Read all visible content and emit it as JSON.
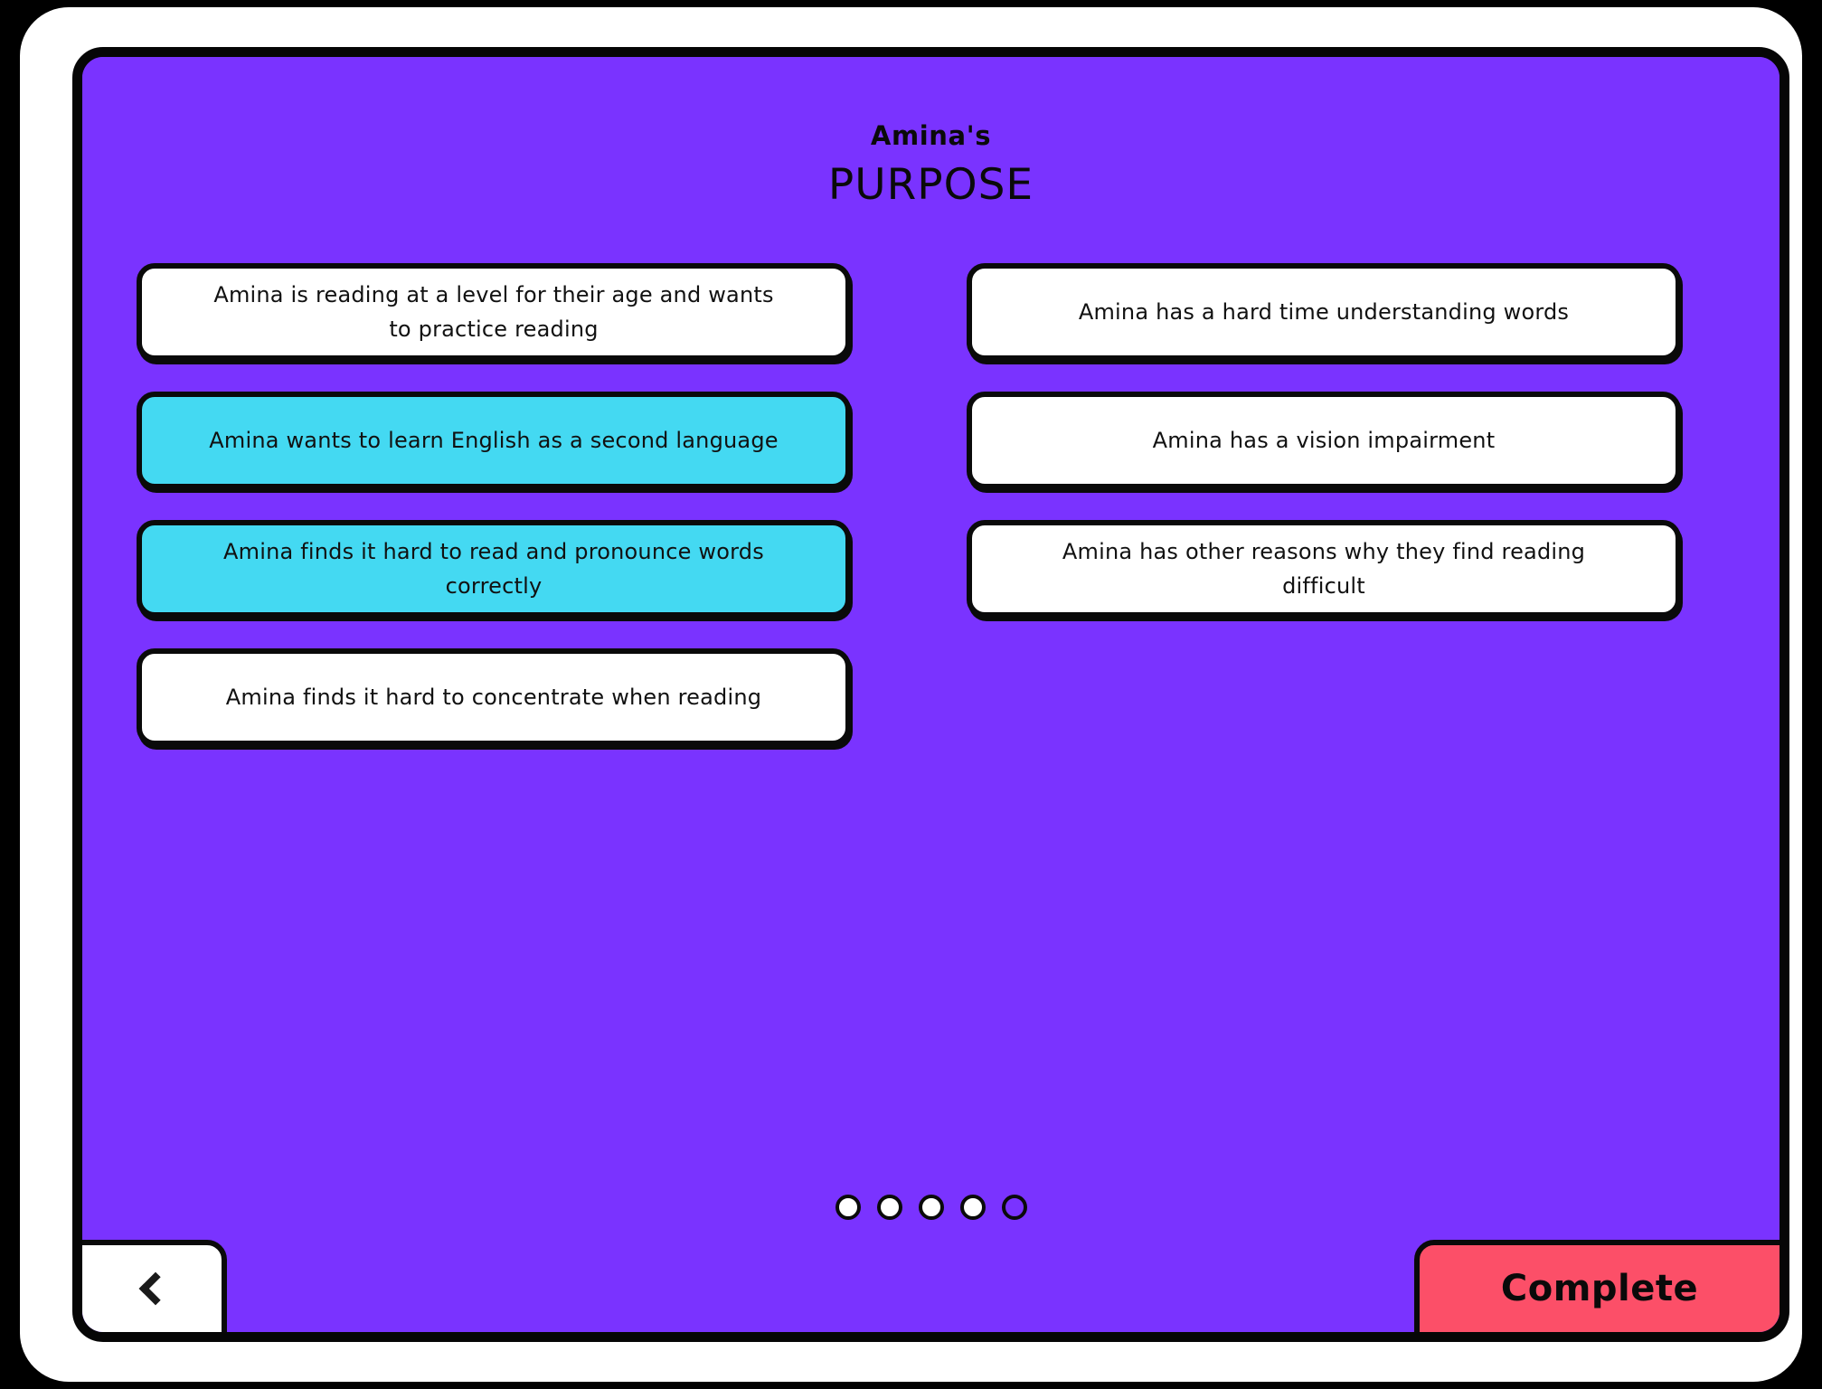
{
  "screen": {
    "background_color": "#7a33ff",
    "frame_color": "#ffffff",
    "border_color": "#0a0a0a"
  },
  "heading": {
    "subtitle": "Amina's",
    "title": "PURPOSE"
  },
  "options": {
    "selected_color": "#44d9f2",
    "unselected_color": "#ffffff",
    "left_column": [
      {
        "label": "Amina is reading at a level for their age and wants to practice reading",
        "selected": false
      },
      {
        "label": "Amina wants to learn English as a second language",
        "selected": true
      },
      {
        "label": "Amina finds it hard to read and pronounce words correctly",
        "selected": true
      },
      {
        "label": "Amina finds it hard to concentrate when reading",
        "selected": false
      }
    ],
    "right_column": [
      {
        "label": "Amina has a hard time understanding words",
        "selected": false
      },
      {
        "label": "Amina has a vision impairment",
        "selected": false
      },
      {
        "label": "Amina has other reasons why they find reading difficult",
        "selected": false
      }
    ]
  },
  "pager": {
    "total": 5,
    "current_index": 4,
    "dots": [
      {
        "state": "filled"
      },
      {
        "state": "filled"
      },
      {
        "state": "filled"
      },
      {
        "state": "filled"
      },
      {
        "state": "current"
      }
    ]
  },
  "footer": {
    "back_icon": "chevron-left-icon",
    "complete_label": "Complete",
    "complete_color": "#fc4f68"
  }
}
